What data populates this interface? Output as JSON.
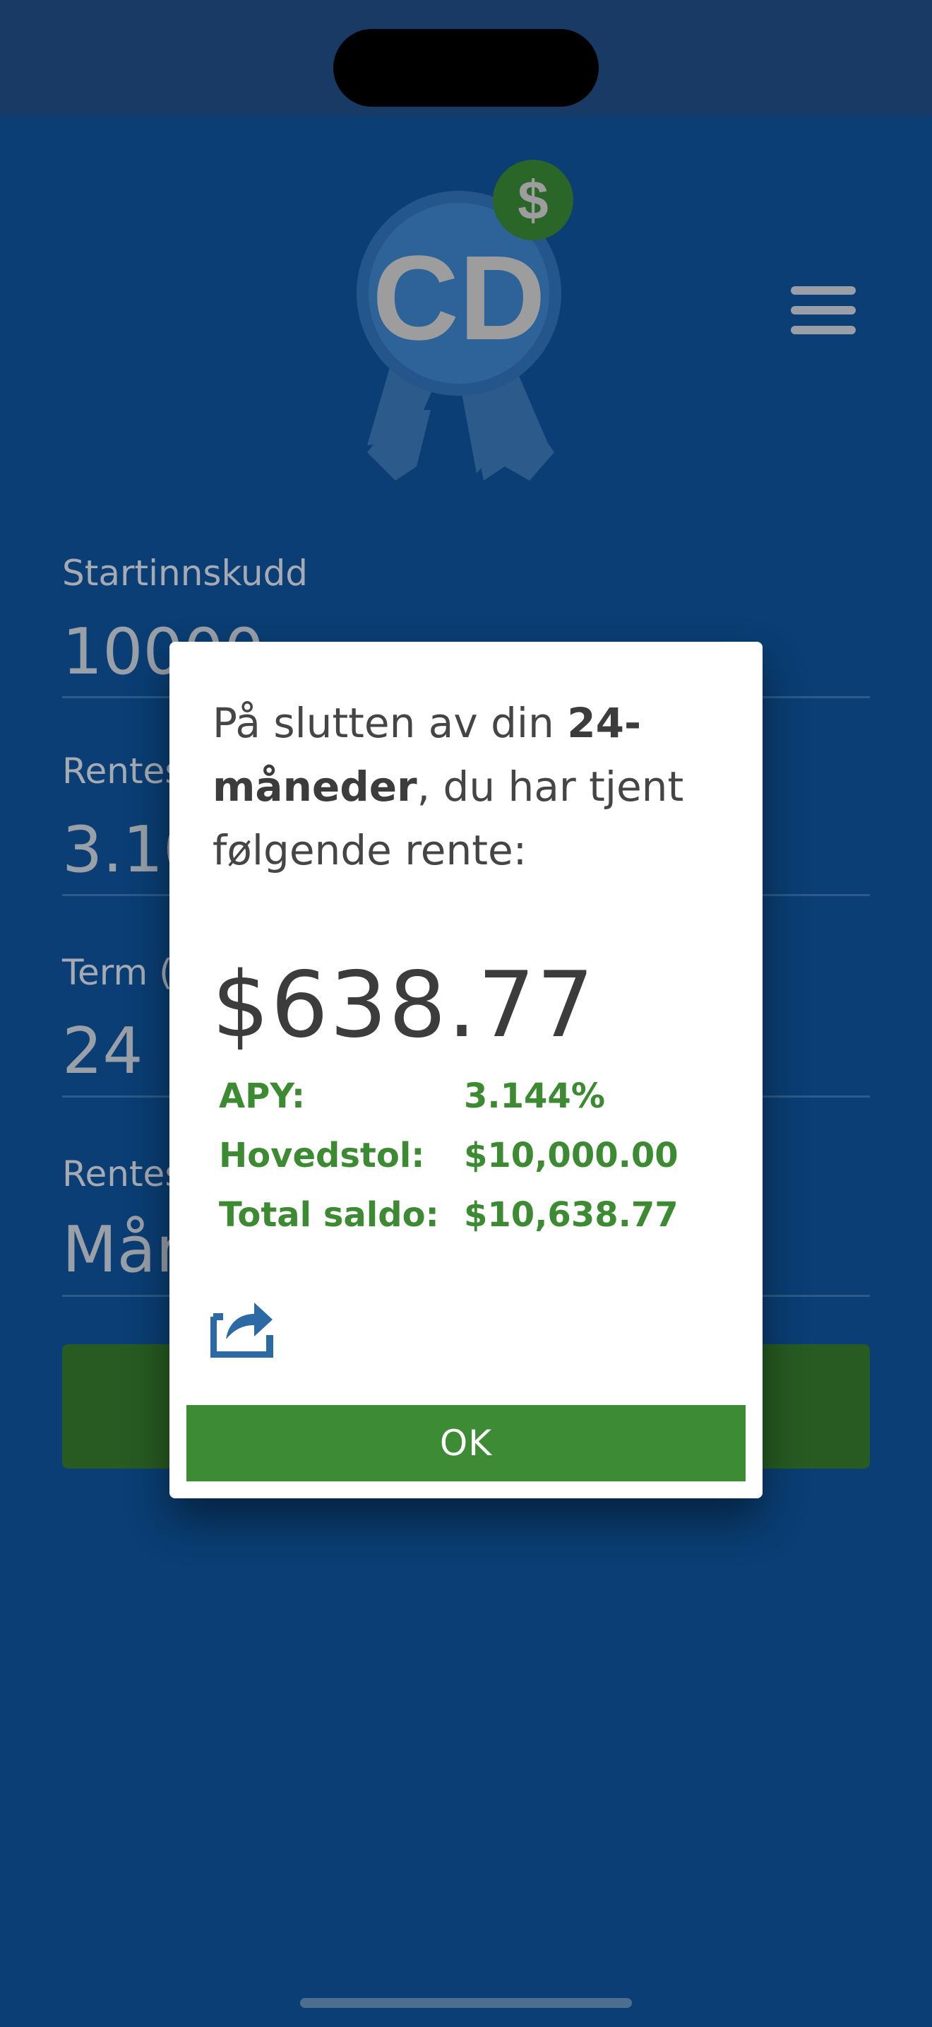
{
  "form": {
    "deposit_label": "Startinnskudd",
    "deposit_value": "10000",
    "rate_label": "Rentes",
    "rate_value": "3.10",
    "term_label": "Term (",
    "term_value": "24",
    "compound_label": "Rentes",
    "compound_value": "Mån"
  },
  "logo": {
    "text": "CD",
    "badge": "$"
  },
  "dialog": {
    "message_prefix": "På slutten av din ",
    "message_term": "24-måneder",
    "message_suffix": ", du har tjent følgende rente:",
    "interest_amount": "$638.77",
    "stats": [
      {
        "label": "APY:",
        "value": "3.144%"
      },
      {
        "label": "Hovedstol:",
        "value": "$10,000.00"
      },
      {
        "label": "Total saldo:",
        "value": "$10,638.77"
      }
    ],
    "ok_label": "OK"
  },
  "colors": {
    "background": "#0a3e74",
    "accent_green": "#3d8b34",
    "stat_green": "#3c8a32",
    "share_blue": "#2c6aa5"
  },
  "icons": [
    "menu-icon",
    "share-icon",
    "dollar-badge-icon",
    "cd-ribbon-logo"
  ]
}
